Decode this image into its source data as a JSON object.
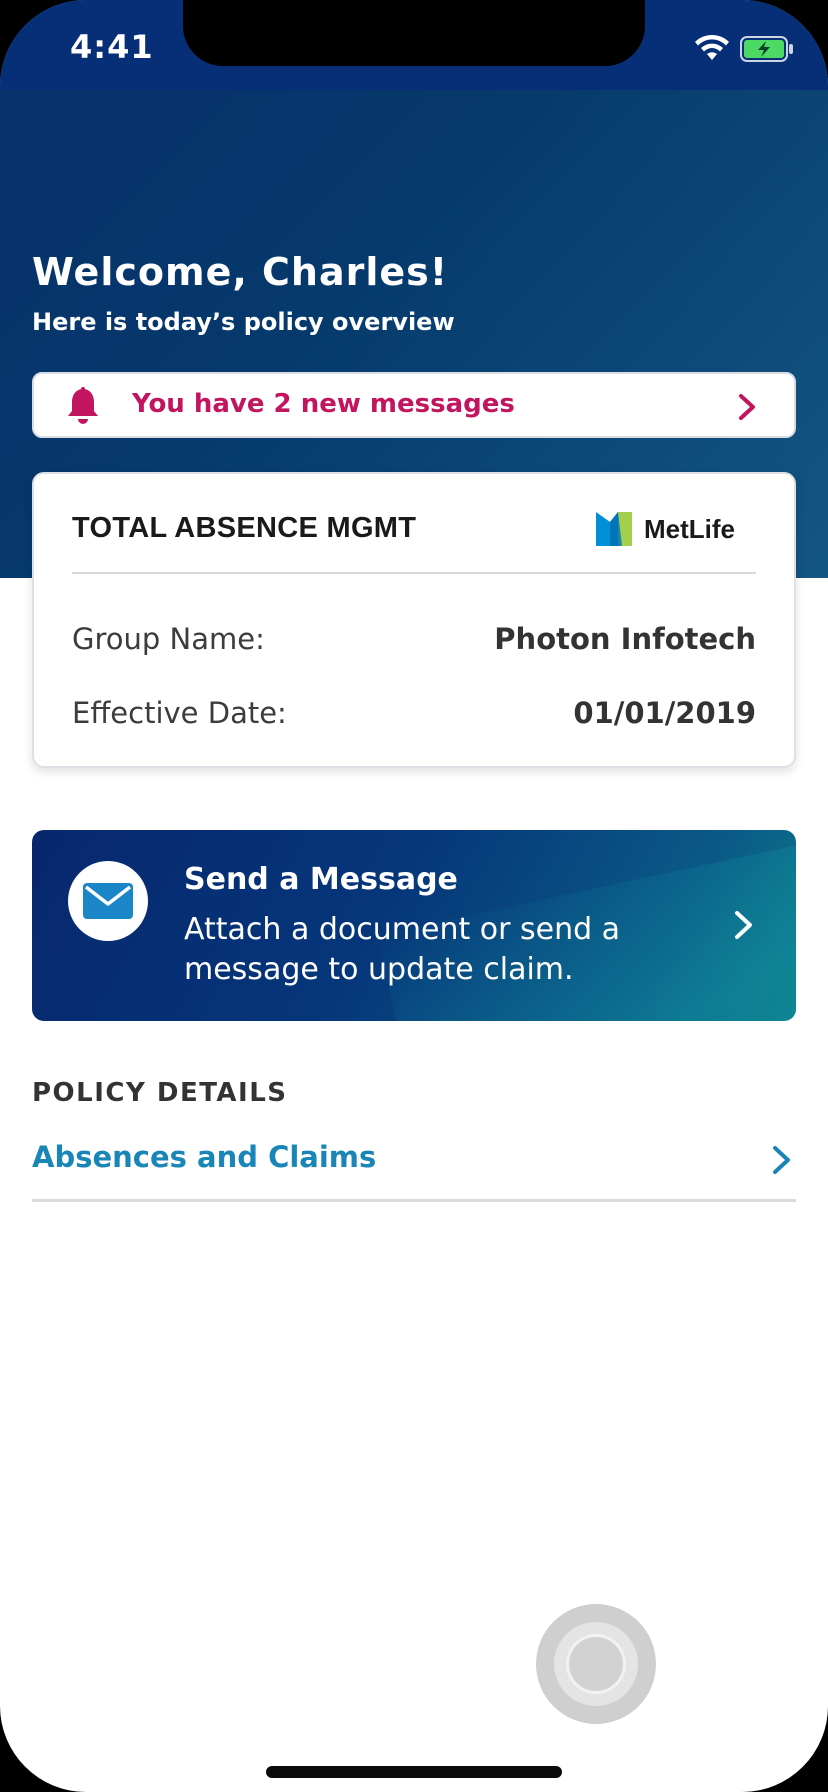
{
  "status_bar": {
    "time": "4:41"
  },
  "header": {
    "welcome": "Welcome, Charles!",
    "subtitle": "Here is today’s policy overview"
  },
  "messages_banner": {
    "text": "You have 2 new messages",
    "icon": "bell-icon",
    "color": "#c3145f"
  },
  "policy_card": {
    "title": "TOTAL ABSENCE MGMT",
    "brand": "MetLife",
    "rows": [
      {
        "label": "Group Name:",
        "value": "Photon Infotech"
      },
      {
        "label": "Effective Date:",
        "value": "01/01/2019"
      }
    ]
  },
  "send_message": {
    "title": "Send a Message",
    "description": "Attach a document or send a message to update claim.",
    "icon": "envelope-icon"
  },
  "policy_details": {
    "section_title": "POLICY DETAILS",
    "link_label": "Absences and Claims",
    "link_color": "#1a86b8"
  },
  "colors": {
    "header_blue": "#07306a",
    "accent_magenta": "#c3145f",
    "link_blue": "#1a86b8"
  }
}
